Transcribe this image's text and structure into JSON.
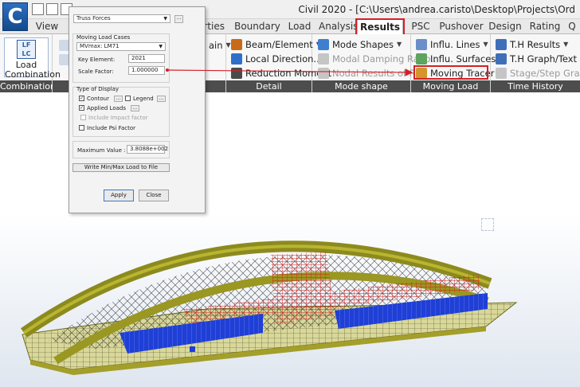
{
  "window": {
    "title": "Civil 2020 - [C:\\Users\\andrea.caristo\\Desktop\\Projects\\Ord"
  },
  "tabs": [
    {
      "label": "View"
    },
    {
      "label": "erties"
    },
    {
      "label": "Boundary"
    },
    {
      "label": "Load"
    },
    {
      "label": "Analysis"
    },
    {
      "label": "Results"
    },
    {
      "label": "PSC"
    },
    {
      "label": "Pushover"
    },
    {
      "label": "Design"
    },
    {
      "label": "Rating"
    },
    {
      "label": "Q"
    }
  ],
  "ribbon": {
    "combination": {
      "button_line1": "Load",
      "button_line2": "Combination",
      "icon_text": "LF LC",
      "group_label": "Combination"
    },
    "partial_item": "ain",
    "detail": {
      "group_label": "Detail",
      "items": [
        "Beam/Element",
        "Local Direction..",
        "Reduction Moment"
      ]
    },
    "mode_shape": {
      "group_label": "Mode shape",
      "items": [
        "Mode Shapes",
        "Modal Damping Ratio..",
        "Nodal Results of RS"
      ]
    },
    "moving_load": {
      "group_label": "Moving Load",
      "items": [
        "Influ. Lines",
        "Influ. Surfaces",
        "Moving Tracer"
      ]
    },
    "time_history": {
      "group_label": "Time History",
      "items": [
        "T.H Results",
        "T.H Graph/Text",
        "Stage/Step Graph"
      ]
    }
  },
  "dialog": {
    "result_type": "Truss Forces",
    "moving_load_cases_label": "Moving Load Cases",
    "moving_load_case_value": "MVmax: LM71",
    "key_element_label": "Key Element:",
    "key_element_value": "2021",
    "scale_factor_label": "Scale Factor:",
    "scale_factor_value": "1.000000",
    "type_of_display_label": "Type of Display",
    "options": [
      {
        "label": "Contour",
        "checked": true,
        "enabled": true
      },
      {
        "label": "Legend",
        "checked": false,
        "enabled": true
      },
      {
        "label": "Applied Loads",
        "checked": true,
        "enabled": true
      },
      {
        "label": "Include Impact factor",
        "checked": false,
        "enabled": false
      },
      {
        "label": "Include Psi Factor",
        "checked": false,
        "enabled": true
      }
    ],
    "max_value_label": "Maximum Value :",
    "max_value": "3.8088e+002",
    "write_button": "Write Min/Max Load to File",
    "apply_button": "Apply",
    "close_button": "Close",
    "dots": "..."
  },
  "colors": {
    "accent_red": "#d32026",
    "structure_olive": "#8c8a1f",
    "load_red": "#d81b1b",
    "load_blue": "#1f3fd6"
  },
  "icons": {
    "beam_element": "beam-icon",
    "local_direction": "axes-icon",
    "reduction_moment": "moment-icon",
    "mode_shapes": "mode-shape-icon",
    "influ_lines": "influence-line-icon",
    "influ_surfaces": "influence-surface-icon",
    "moving_tracer": "truck-icon",
    "th_results": "th-results-icon",
    "th_graph": "graph-icon",
    "stage_step": "stage-graph-icon"
  }
}
